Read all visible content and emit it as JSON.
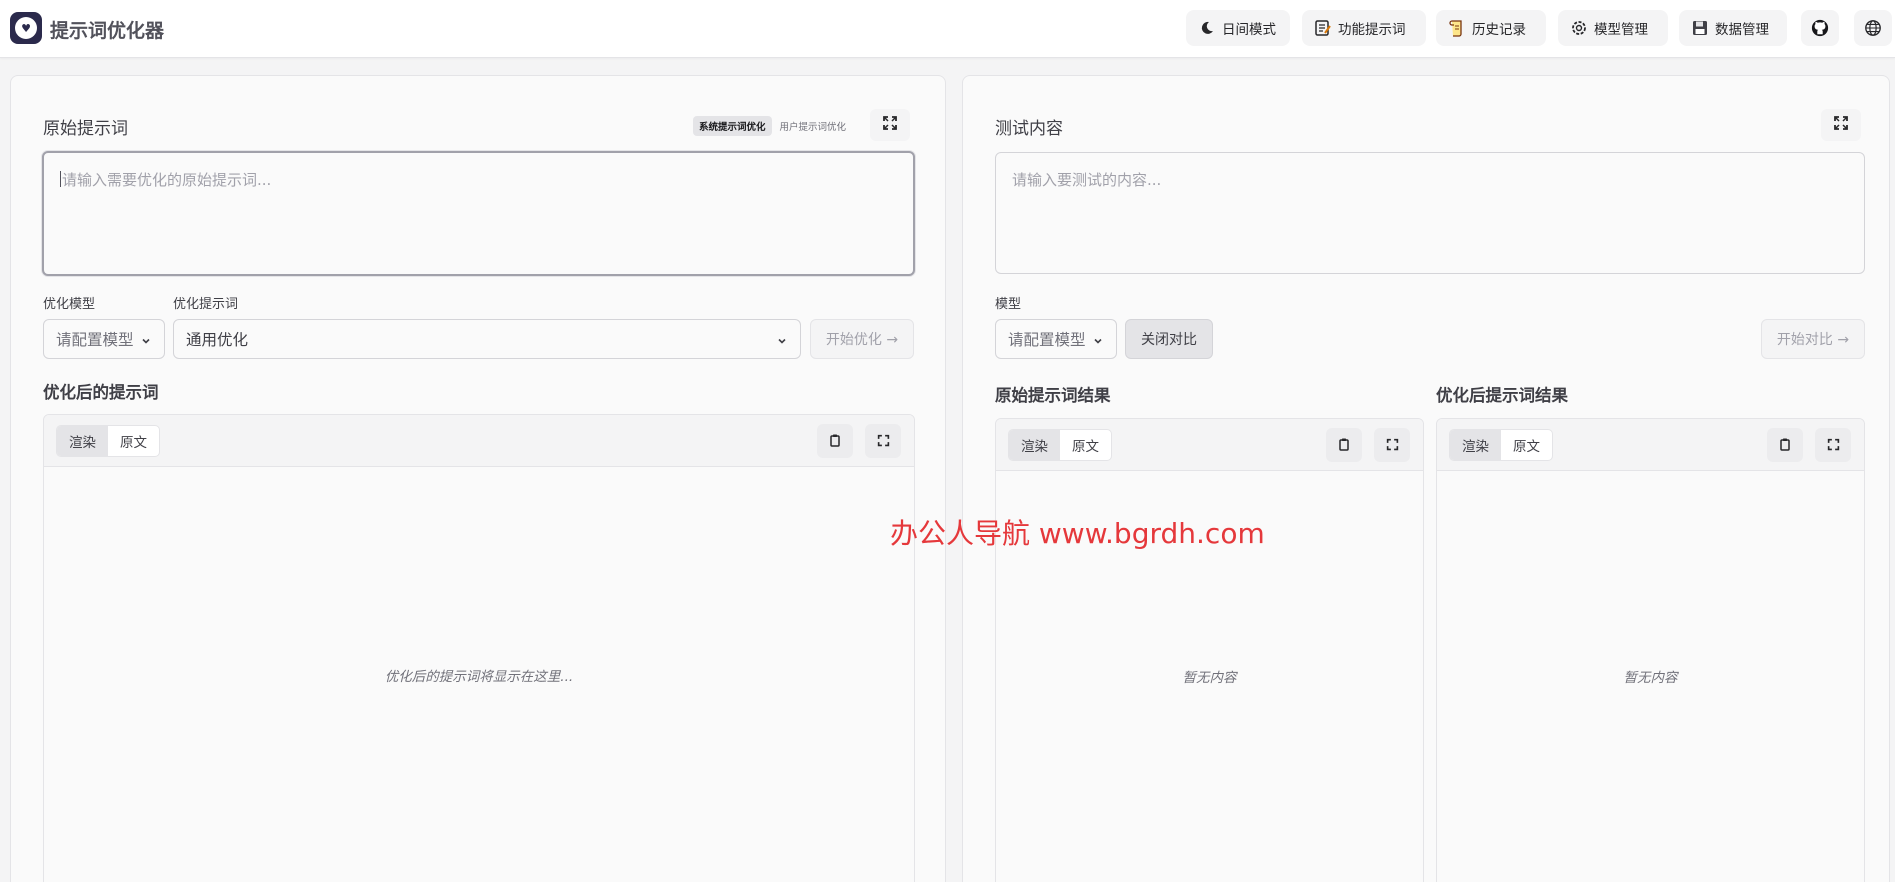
{
  "app": {
    "title": "提示词优化器"
  },
  "header": {
    "buttons": [
      {
        "label": "日间模式",
        "icon": "moon-icon"
      },
      {
        "label": "功能提示词",
        "icon": "notepad-icon"
      },
      {
        "label": "历史记录",
        "icon": "scroll-icon"
      },
      {
        "label": "模型管理",
        "icon": "gear-icon"
      },
      {
        "label": "数据管理",
        "icon": "floppy-disk-icon"
      }
    ],
    "github_icon": "github-icon",
    "language_icon": "globe-icon"
  },
  "left": {
    "title": "原始提示词",
    "mode_active": "系统提示词优化",
    "mode_inactive": "用户提示词优化",
    "input_placeholder": "请输入需要优化的原始提示词...",
    "model_label": "优化模型",
    "model_value": "请配置模型",
    "template_label": "优化提示词",
    "template_value": "通用优化",
    "start_button": "开始优化 →",
    "output_title": "优化后的提示词",
    "tab_render": "渲染",
    "tab_source": "原文",
    "output_placeholder": "优化后的提示词将显示在这里..."
  },
  "right": {
    "title": "测试内容",
    "input_placeholder": "请输入要测试的内容...",
    "model_label": "模型",
    "model_value": "请配置模型",
    "compare_toggle": "关闭对比",
    "start_button": "开始对比 →",
    "original_result_title": "原始提示词结果",
    "optimized_result_title": "优化后提示词结果",
    "tab_render": "渲染",
    "tab_source": "原文",
    "empty_text": "暂无内容"
  },
  "watermark": "办公人导航  www.bgrdh.com"
}
